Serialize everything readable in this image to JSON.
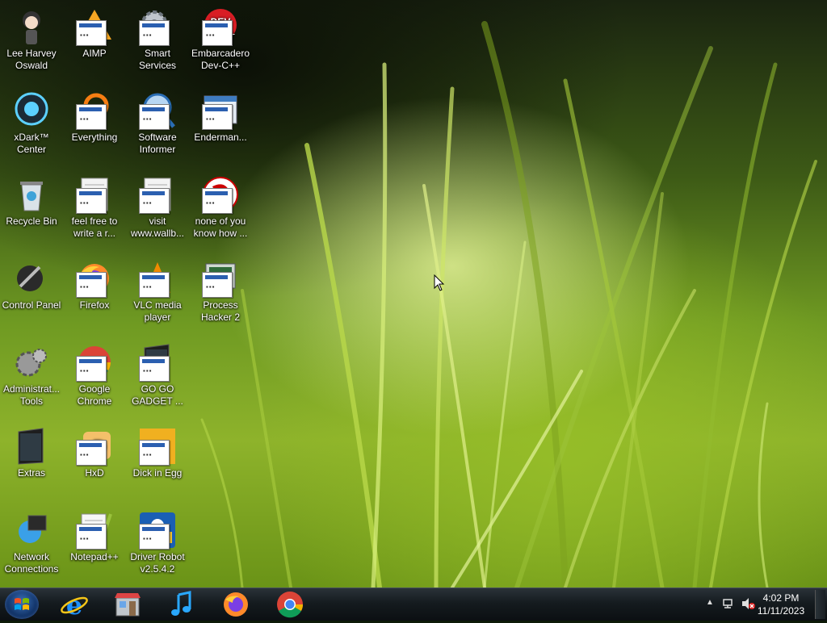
{
  "desktop": {
    "icons": [
      {
        "label": "Lee Harvey Oswald",
        "icon": "anime-character-icon"
      },
      {
        "label": "AIMP",
        "icon": "aimp-icon"
      },
      {
        "label": "Smart Services",
        "icon": "gear-icon"
      },
      {
        "label": "Embarcadero Dev-C++",
        "icon": "dev-cpp-icon"
      },
      {
        "label": "xDark™ Center",
        "icon": "xdark-icon"
      },
      {
        "label": "Everything",
        "icon": "everything-search-icon"
      },
      {
        "label": "Software Informer",
        "icon": "magnifier-icon"
      },
      {
        "label": "Enderman...",
        "icon": "window-icon"
      },
      {
        "label": "Recycle Bin",
        "icon": "recycle-bin-icon"
      },
      {
        "label": "feel free to write a r...",
        "icon": "text-file-icon"
      },
      {
        "label": "visit www.wallb...",
        "icon": "text-file-icon"
      },
      {
        "label": "none of you know how ...",
        "icon": "red-bird-icon"
      },
      {
        "label": "Control Panel",
        "icon": "control-panel-icon"
      },
      {
        "label": "Firefox",
        "icon": "firefox-icon"
      },
      {
        "label": "VLC media player",
        "icon": "vlc-icon"
      },
      {
        "label": "Process Hacker 2",
        "icon": "process-hacker-icon"
      },
      {
        "label": "Administrat... Tools",
        "icon": "admin-tools-icon"
      },
      {
        "label": "Google Chrome",
        "icon": "chrome-icon"
      },
      {
        "label": "GO GO GADGET ...",
        "icon": "black-folder-icon"
      },
      {
        "label": "Extras",
        "icon": "black-folder-icon"
      },
      {
        "label": "HxD",
        "icon": "hxd-icon"
      },
      {
        "label": "Dick in Egg",
        "icon": "egg-game-icon"
      },
      {
        "label": "Network Connections",
        "icon": "network-icon"
      },
      {
        "label": "Notepad++",
        "icon": "notepad-plus-plus-icon"
      },
      {
        "label": "Driver Robot v2.5.4.2",
        "icon": "driver-robot-icon"
      }
    ]
  },
  "taskbar": {
    "start_icon": "windows-start-orb-icon",
    "pinned": [
      {
        "name": "Internet Explorer",
        "icon": "internet-explorer-icon"
      },
      {
        "name": "Store",
        "icon": "store-icon"
      },
      {
        "name": "Music",
        "icon": "music-note-icon"
      },
      {
        "name": "Firefox",
        "icon": "firefox-icon"
      },
      {
        "name": "Google Chrome",
        "icon": "chrome-icon"
      }
    ],
    "tray": {
      "overflow_icon": "chevron-up-icon",
      "network_icon": "network-icon",
      "volume_icon": "volume-muted-icon",
      "time": "4:02 PM",
      "date": "11/11/2023"
    }
  }
}
